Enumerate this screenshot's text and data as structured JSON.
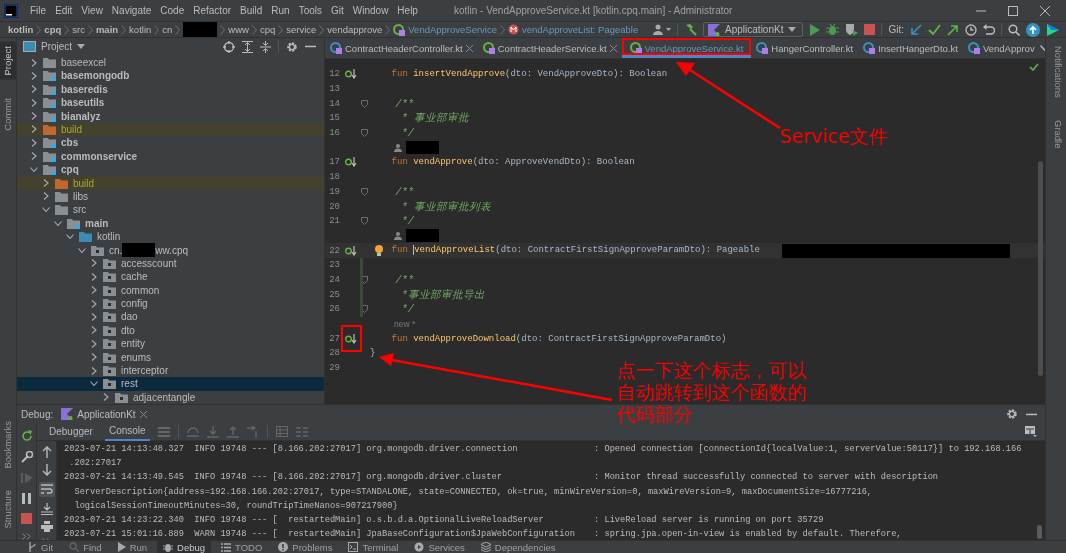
{
  "window": {
    "title": "kotlin - VendApproveService.kt [kotlin.cpq.main] - Administrator"
  },
  "menu": [
    "File",
    "Edit",
    "View",
    "Navigate",
    "Code",
    "Refactor",
    "Build",
    "Run",
    "Tools",
    "Git",
    "Window",
    "Help"
  ],
  "breadcrumbs": [
    {
      "kind": "folder",
      "label": "kotlin",
      "bold": true
    },
    {
      "kind": "folder",
      "label": "cpq",
      "bold": true
    },
    {
      "kind": "folder",
      "label": "src",
      "bold": false
    },
    {
      "kind": "folder",
      "label": "main",
      "bold": true
    },
    {
      "kind": "folder",
      "label": "kotlin",
      "bold": false
    },
    {
      "kind": "folder",
      "label": "cn",
      "bold": false
    },
    {
      "kind": "redacted"
    },
    {
      "kind": "folder",
      "label": "www",
      "bold": false
    },
    {
      "kind": "folder",
      "label": "cpq",
      "bold": false
    },
    {
      "kind": "folder",
      "label": "service",
      "bold": false
    },
    {
      "kind": "folder",
      "label": "vendapprove",
      "bold": false
    },
    {
      "kind": "interface",
      "label": "VendApproveService"
    },
    {
      "kind": "method",
      "label": "vendApproveList: Pageable"
    }
  ],
  "toolbar": {
    "run_config": "ApplicationKt",
    "git_label": "Git:"
  },
  "left_strip": [
    {
      "label": "Project",
      "selected": true
    },
    {
      "label": "Commit",
      "selected": false
    }
  ],
  "left_strip_bottom": [
    {
      "label": "Bookmarks",
      "selected": false
    },
    {
      "label": "Structure",
      "selected": false
    }
  ],
  "right_strip": [
    {
      "label": "Notifications",
      "selected": false
    },
    {
      "label": "Gradle",
      "selected": false
    }
  ],
  "project": {
    "title": "Project",
    "tree": [
      {
        "label": "baseexcel",
        "kind": "folder",
        "expanded": false,
        "selected": false
      },
      {
        "label": "basemongodb",
        "kind": "module",
        "expanded": false,
        "selected": false
      },
      {
        "label": "baseredis",
        "kind": "module",
        "expanded": false,
        "selected": false
      },
      {
        "label": "baseutils",
        "kind": "module",
        "expanded": false,
        "selected": false
      },
      {
        "label": "bianalyz",
        "kind": "module",
        "expanded": false,
        "selected": false
      },
      {
        "label": "build",
        "kind": "excluded",
        "expanded": false,
        "selected": false
      },
      {
        "label": "cbs",
        "kind": "module",
        "expanded": false,
        "selected": false
      },
      {
        "label": "commonservice",
        "kind": "module",
        "expanded": false,
        "selected": false
      },
      {
        "label": "cpq",
        "kind": "module",
        "expanded": true,
        "selected": false,
        "children": [
          {
            "label": "build",
            "kind": "excluded",
            "expanded": false,
            "selected": false
          },
          {
            "label": "libs",
            "kind": "folder",
            "expanded": false,
            "selected": false
          },
          {
            "label": "src",
            "kind": "folder",
            "expanded": true,
            "selected": false,
            "children": [
              {
                "label": "main",
                "kind": "module",
                "expanded": true,
                "selected": false,
                "children": [
                  {
                    "label": "kotlin",
                    "kind": "source",
                    "expanded": true,
                    "selected": false,
                    "children": [
                      {
                        "label": "cn.",
                        "suffix": "ww.cpq",
                        "kind": "package",
                        "expanded": true,
                        "selected": false,
                        "children": [
                          {
                            "label": "accesscount",
                            "kind": "package",
                            "expanded": false,
                            "selected": false
                          },
                          {
                            "label": "cache",
                            "kind": "package",
                            "expanded": false,
                            "selected": false
                          },
                          {
                            "label": "common",
                            "kind": "package",
                            "expanded": false,
                            "selected": false
                          },
                          {
                            "label": "config",
                            "kind": "package",
                            "expanded": false,
                            "selected": false
                          },
                          {
                            "label": "dao",
                            "kind": "package",
                            "expanded": false,
                            "selected": false
                          },
                          {
                            "label": "dto",
                            "kind": "package",
                            "expanded": false,
                            "selected": false
                          },
                          {
                            "label": "entity",
                            "kind": "package",
                            "expanded": false,
                            "selected": false
                          },
                          {
                            "label": "enums",
                            "kind": "package",
                            "expanded": false,
                            "selected": false
                          },
                          {
                            "label": "interceptor",
                            "kind": "package",
                            "expanded": false,
                            "selected": false
                          },
                          {
                            "label": "rest",
                            "kind": "package",
                            "expanded": true,
                            "selected": true,
                            "children": [
                              {
                                "label": "adjacentangle",
                                "kind": "package",
                                "expanded": false,
                                "selected": false
                              }
                            ]
                          }
                        ]
                      }
                    ]
                  }
                ]
              }
            ]
          }
        ]
      }
    ]
  },
  "editor": {
    "tabs": [
      {
        "label": "ContractHeaderController.kt",
        "kind": "class",
        "selected": false,
        "closable": true
      },
      {
        "label": "ContractHeaderService.kt",
        "kind": "interface",
        "selected": false,
        "closable": true
      },
      {
        "label": "VendApproveService.kt",
        "kind": "interface",
        "selected": true,
        "closable": false
      },
      {
        "label": "HangerController.kt",
        "kind": "class",
        "selected": false,
        "closable": false
      },
      {
        "label": "InsertHangerDto.kt",
        "kind": "class",
        "selected": false,
        "closable": false
      },
      {
        "label": "VendApprov",
        "kind": "class",
        "selected": false,
        "closable": false
      }
    ],
    "lines": [
      {
        "number": "12",
        "kind": "code",
        "keyword": "fun",
        "name": "insertVendApprove",
        "rest": "(dto: VendApproveDto): Boolean",
        "implemented": true,
        "fold": false,
        "changed": false,
        "current": false
      },
      {
        "number": "13",
        "kind": "blank",
        "implemented": false,
        "fold": false,
        "changed": false,
        "current": false
      },
      {
        "number": "14",
        "kind": "comment",
        "text": "/**",
        "implemented": false,
        "fold": true,
        "changed": false,
        "current": false
      },
      {
        "number": "15",
        "kind": "comment",
        "text": " * 事业部审批",
        "implemented": false,
        "fold": false,
        "changed": false,
        "current": false
      },
      {
        "number": "16",
        "kind": "comment",
        "text": " */",
        "implemented": false,
        "fold": true,
        "changed": false,
        "current": false
      },
      {
        "kind": "author"
      },
      {
        "number": "17",
        "kind": "code",
        "keyword": "fun",
        "name": "vendApprove",
        "rest": "(dto: ApproveVendDto): Boolean",
        "implemented": true,
        "fold": false,
        "changed": false,
        "current": false
      },
      {
        "number": "18",
        "kind": "blank",
        "implemented": false,
        "fold": false,
        "changed": false,
        "current": false
      },
      {
        "number": "19",
        "kind": "comment",
        "text": "/**",
        "implemented": false,
        "fold": true,
        "changed": false,
        "current": false
      },
      {
        "number": "20",
        "kind": "comment",
        "text": " * 事业部审批列表",
        "implemented": false,
        "fold": false,
        "changed": false,
        "current": false
      },
      {
        "number": "21",
        "kind": "comment",
        "text": " */",
        "implemented": false,
        "fold": true,
        "changed": false,
        "current": false
      },
      {
        "kind": "author"
      },
      {
        "number": "22",
        "kind": "code",
        "keyword": "fun",
        "name": "vendApproveList",
        "rest": "(dto: ContractFirstSignApproveParamDto): Pageable",
        "implemented": true,
        "fold": false,
        "changed": false,
        "current": true
      },
      {
        "number": "23",
        "kind": "blank",
        "implemented": false,
        "fold": false,
        "changed": true,
        "current": false
      },
      {
        "number": "24",
        "kind": "comment",
        "text": "/**",
        "implemented": false,
        "fold": true,
        "changed": true,
        "current": false
      },
      {
        "number": "25",
        "kind": "comment",
        "text": " *事业部审批导出",
        "implemented": false,
        "fold": false,
        "changed": true,
        "current": false
      },
      {
        "number": "26",
        "kind": "comment",
        "text": " */",
        "implemented": false,
        "fold": true,
        "changed": true,
        "current": false
      },
      {
        "kind": "hint",
        "text": "new *"
      },
      {
        "number": "27",
        "kind": "code",
        "keyword": "fun",
        "name": "vendApproveDownload",
        "rest": "(dto: ContractFirstSignApproveParamDto)",
        "implemented": true,
        "fold": false,
        "changed": false,
        "current": false
      },
      {
        "number": "28",
        "kind": "plain",
        "text": "}",
        "implemented": false,
        "fold": false,
        "changed": false,
        "current": false
      },
      {
        "number": "29",
        "kind": "blank",
        "implemented": false,
        "fold": false,
        "changed": false,
        "current": false
      }
    ]
  },
  "debug": {
    "label": "Debug:",
    "tab": "ApplicationKt",
    "subtabs": [
      {
        "label": "Debugger",
        "selected": false
      },
      {
        "label": "Console",
        "selected": true
      }
    ],
    "soft_wrap_on": true,
    "resume_enabled": false,
    "console": [
      {
        "prefix": "2023-07-21 14:13:48.327  INFO 19748 --- [8.166.202:27017] org.mongodb.driver.connection",
        "message": ": Opened connection [connectionId{localValue:1, serverValue:50117}] to 192.168.166"
      },
      {
        "text": " .202:27017"
      },
      {
        "prefix": "2023-07-21 14:13:49.545  INFO 19748 --- [8.166.202:27017] org.mongodb.driver.cluster",
        "message": ": Monitor thread successfully connected to server with description"
      },
      {
        "text": "  ServerDescription{address=192.168.166.202:27017, type=STANDALONE, state=CONNECTED, ok=true, minWireVersion=0, maxWireVersion=9, maxDocumentSize=16777216,"
      },
      {
        "text": "  logicalSessionTimeoutMinutes=30, roundTripTimeNanos=907217900}"
      },
      {
        "prefix": "2023-07-21 14:23:22.340  INFO 19748 --- [  restartedMain] o.s.b.d.a.OptionalLiveReloadServer",
        "message": ": LiveReload server is running on port 35729"
      },
      {
        "prefix": "2023-07-21 15:01:16.889  WARN 19748 --- [  restartedMain] JpaBaseConfiguration$JpaWebConfiguration",
        "message": ": spring.jpa.open-in-view is enabled by default. Therefore,"
      }
    ]
  },
  "bottom_bar": [
    {
      "label": "Git",
      "kind": "git",
      "selected": false
    },
    {
      "label": "Find",
      "kind": "find",
      "selected": false
    },
    {
      "label": "Run",
      "kind": "run",
      "selected": false
    },
    {
      "label": "Debug",
      "kind": "debug",
      "selected": true
    },
    {
      "label": "TODO",
      "kind": "list",
      "selected": false
    },
    {
      "label": "Problems",
      "kind": "problems",
      "selected": false
    },
    {
      "label": "Terminal",
      "kind": "terminal",
      "selected": false
    },
    {
      "label": "Services",
      "kind": "services",
      "selected": false
    },
    {
      "label": "Dependencies",
      "kind": "deps",
      "selected": false
    }
  ],
  "annotations": [
    {
      "text": "Service文件"
    },
    {
      "text": "点一下这个标志，可以自动跳转到这个函数的代码部分"
    }
  ]
}
